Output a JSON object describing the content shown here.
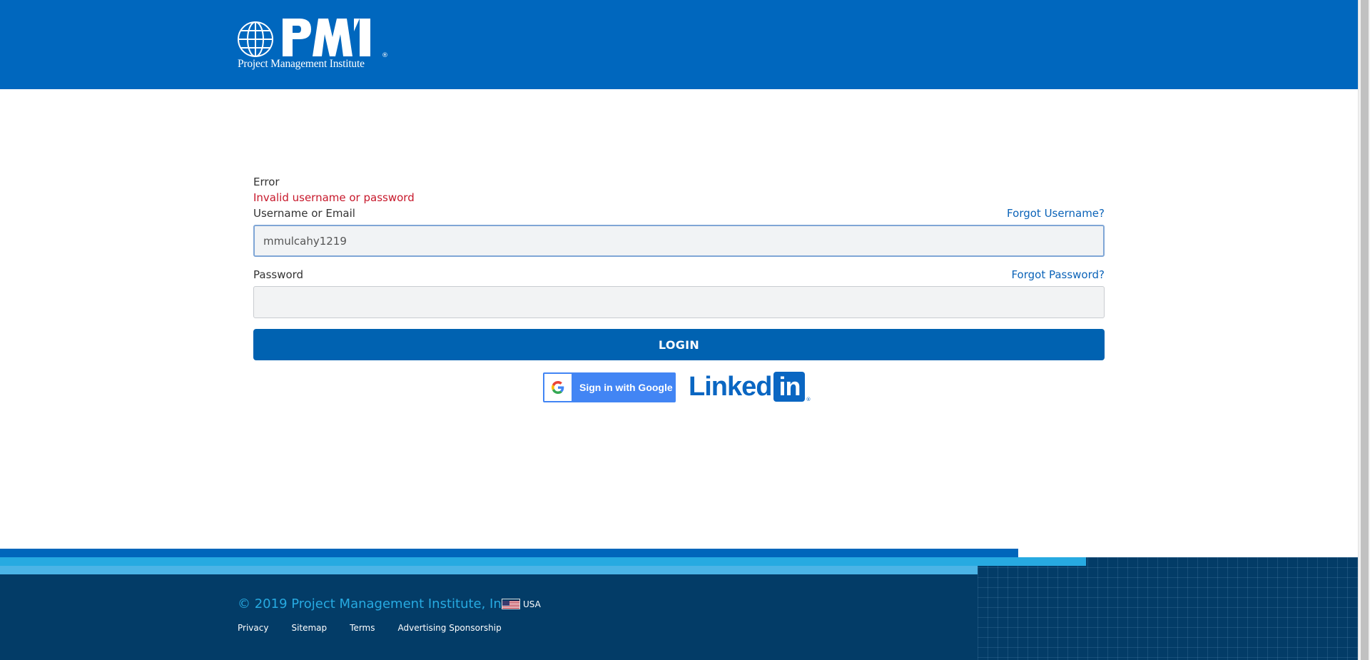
{
  "header": {
    "logo_text": "Project Management Institute",
    "logo_letters": "PMI"
  },
  "form": {
    "error_title": "Error",
    "error_message": "Invalid username or password",
    "username_label": "Username or Email",
    "username_value": "mmulcahy1219",
    "forgot_username": "Forgot Username?",
    "password_label": "Password",
    "password_value": "",
    "forgot_password": "Forgot Password?",
    "login_label": "LOGIN"
  },
  "social": {
    "google_label": "Sign in with Google",
    "linkedin_text": "Linked",
    "linkedin_box": "in"
  },
  "footer": {
    "copyright": "© 2019 Project Management Institute, Inc.",
    "country": "USA",
    "links": [
      "Privacy",
      "Sitemap",
      "Terms",
      "Advertising Sponsorship"
    ]
  },
  "colors": {
    "brand_blue": "#0067be",
    "button_blue": "#0062b1",
    "error_red": "#c7182b",
    "footer_navy": "#033c67",
    "footer_accent": "#27aae1"
  },
  "icons": [
    "pmi-globe-logo",
    "google-g-icon",
    "linkedin-logo",
    "us-flag-icon"
  ]
}
